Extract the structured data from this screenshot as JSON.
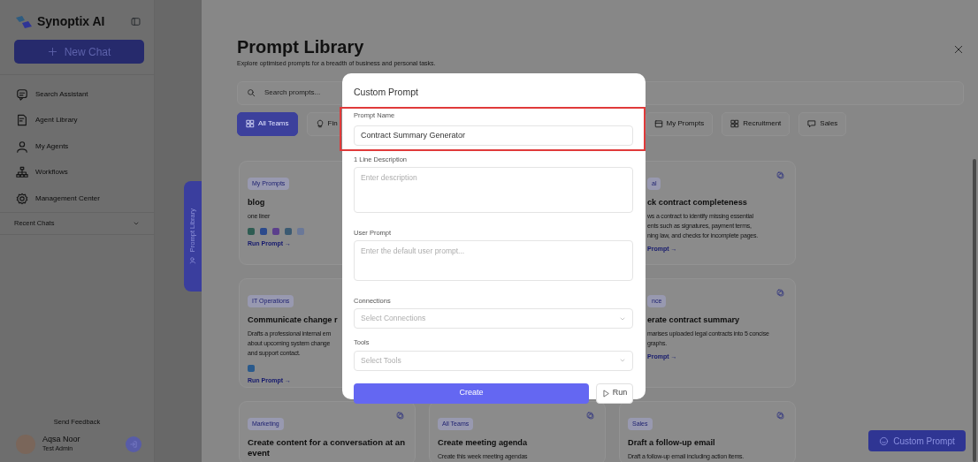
{
  "sidebar": {
    "brand": "Synoptix AI",
    "new_chat": "New Chat",
    "nav": [
      {
        "label": "Search Assistant"
      },
      {
        "label": "Agent Library"
      },
      {
        "label": "My Agents"
      },
      {
        "label": "Workflows"
      },
      {
        "label": "Management Center"
      }
    ],
    "recent_chats": {
      "label": "Recent Chats",
      "expanded": false
    },
    "send_feedback": "Send Feedback",
    "user": {
      "name": "Aqsa Noor",
      "role": "Test Admin"
    }
  },
  "side_tab": "Prompt Library",
  "library": {
    "title": "Prompt Library",
    "subtitle": "Explore optimised prompts for a breadth of business and personal tasks.",
    "search": {
      "placeholder": "Search prompts..."
    },
    "filters": [
      {
        "label": "All Teams",
        "selected": true
      },
      {
        "label": "Fin",
        "selected": false
      },
      {
        "label": "My Prompts",
        "selected": false
      },
      {
        "label": "Recruitment",
        "selected": false
      },
      {
        "label": "Sales",
        "selected": false
      }
    ],
    "columns": [
      [
        {
          "badge": "My Prompts",
          "title": "blog",
          "description": [
            "one liner"
          ],
          "tool_icons": [
            {
              "color": "#2e5c52"
            },
            {
              "color": "#2c4a8c"
            },
            {
              "color": "#5b3f8c"
            },
            {
              "color": "#3b5a72"
            },
            {
              "color": "#6a7898"
            }
          ],
          "run_link": "Run Prompt →",
          "copy_icon": false
        },
        {
          "badge": "IT Operations",
          "title": "Communicate change r",
          "description": [
            "Drafts a professional internal em",
            "about upcoming system change",
            "and support contact."
          ],
          "tool_icons": [
            {
              "color": "#2a5a8c"
            }
          ],
          "run_link": "Run Prompt →",
          "copy_icon": false
        },
        {
          "badge": "Marketing",
          "title": "Create content for a conversation at an event",
          "copy_icon": true
        }
      ],
      [
        {
          "badge": "All Teams",
          "title": "Create meeting agenda",
          "description": [
            "Create this week meeting agendas"
          ],
          "copy_icon": true
        }
      ],
      [
        {
          "badge": "al",
          "title": "ck contract completeness",
          "description": [
            "ws a contract to identify missing essential",
            "ents such as signatures, payment terms,",
            "ning law, and checks for incomplete pages."
          ],
          "run_link": "Prompt →",
          "copy_icon": true
        },
        {
          "badge": "nce",
          "title": "erate contract summary",
          "description": [
            "marises uploaded legal contracts into 5 concise",
            "graphs."
          ],
          "run_link": "Prompt →",
          "copy_icon": true
        },
        {
          "badge": "Sales",
          "title": "Draft a follow-up email",
          "description": [
            "Draft a follow-up email including action items."
          ],
          "copy_icon": true
        }
      ]
    ],
    "custom_prompt_button": "Custom Prompt"
  },
  "modal": {
    "title": "Custom Prompt",
    "fields": [
      {
        "kind": "text",
        "label": "Prompt Name",
        "value": "Contract Summary Generator",
        "highlighted": true
      },
      {
        "kind": "textarea",
        "label": "1 Line Description",
        "placeholder": "Enter description",
        "highlighted": false
      },
      {
        "kind": "textarea",
        "label": "User Prompt",
        "placeholder": "Enter the default user prompt...",
        "highlighted": false
      },
      {
        "kind": "select",
        "label": "Connections",
        "placeholder": "Select Connections",
        "highlighted": false
      },
      {
        "kind": "select",
        "label": "Tools",
        "placeholder": "Select Tools",
        "highlighted": false
      }
    ],
    "create_button": "Create",
    "run_button": "Run"
  }
}
